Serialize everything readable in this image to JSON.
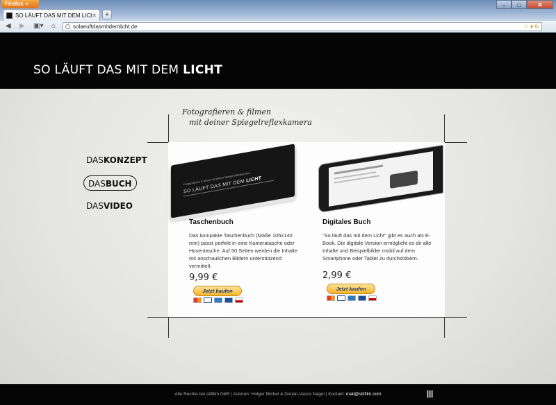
{
  "browser": {
    "app_button": "Firefox",
    "tab_title": "SO LÄUFT DAS MIT DEM LICHT",
    "url": "solaeuftdasmitdemlicht.de"
  },
  "site": {
    "title_regular": "SO LÄUFT DAS MIT DEM ",
    "title_bold": "LICHT",
    "tagline_line1": "Fotografieren & filmen",
    "tagline_line2": "mit deiner Spiegelreflexkamera"
  },
  "menu": [
    {
      "prefix": "DAS",
      "bold": "KONZEPT",
      "active": false
    },
    {
      "prefix": "DAS",
      "bold": "BUCH",
      "active": true
    },
    {
      "prefix": "DAS",
      "bold": "VIDEO",
      "active": false
    }
  ],
  "book_cover": {
    "subtitle": "Fotografieren & filmen mit deiner Spiegelreflexkamera",
    "title_regular": "SO LÄUFT DAS MIT DEM ",
    "title_bold": "LICHT"
  },
  "products": [
    {
      "title": "Taschenbuch",
      "description": "Das kompakte Taschenbuch (Maße 105x140 mm) passt perfekt in eine Kameratasche oder Hosentasche. Auf 50 Seiten werden die Inhalte mit anschaulichen Bildern unterstützend vermittelt.",
      "price": "9,99 €",
      "button": "Jetzt kaufen"
    },
    {
      "title": "Digitales Buch",
      "description": "\"So läuft das mit dem Licht\" gibt es auch als E-Book. Die digitale Version ermöglicht es dir alle Inhalte und Beispielbilder mobil auf dem Smartphone oder Tablet zu durchstöbern.",
      "price": "2,99 €",
      "button": "Jetzt kaufen"
    }
  ],
  "payment_cards": [
    "mastercard",
    "visa",
    "amex",
    "giropay",
    "ec"
  ],
  "footer": {
    "text": "Alle Rechte bei stilfilm GbR | Autoren: Holger Michel & Dorian-Vasco Nagel | Kontakt: ",
    "email": "mail@stilfilm.com"
  },
  "colors": {
    "header_bg": "#050505",
    "paypal_button": "#f6b32b"
  }
}
